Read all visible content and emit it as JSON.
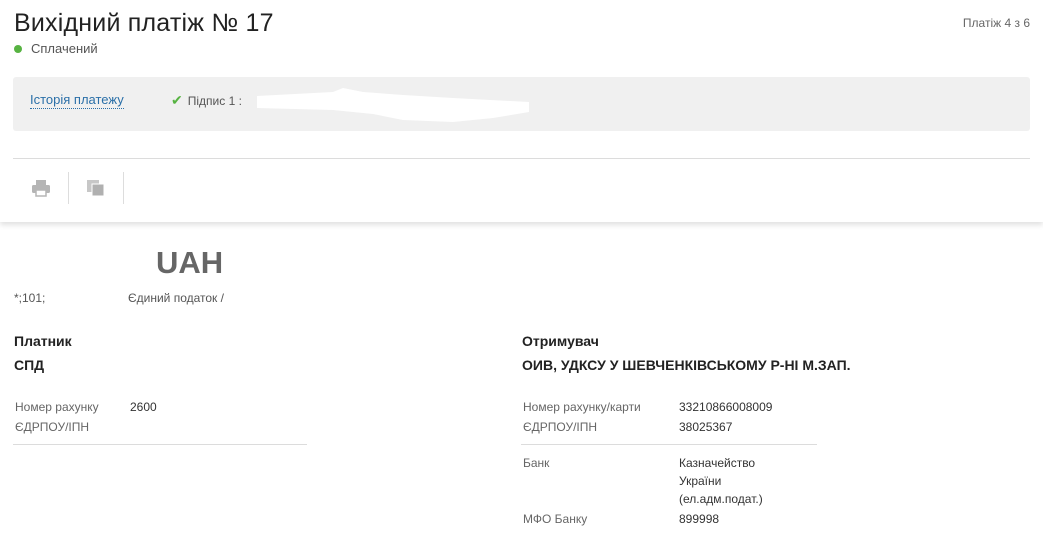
{
  "header": {
    "title": "Вихідний платіж № 17",
    "status": "Сплачений",
    "status_color": "#57b342",
    "counter": "Платіж 4 з 6"
  },
  "infobar": {
    "history_link": "Історія платежу",
    "signature_label": "Підпис 1 :"
  },
  "toolbar": {
    "items": [
      {
        "icon": "printer-icon"
      },
      {
        "icon": "copy-icon"
      }
    ]
  },
  "payment": {
    "currency": "UAH",
    "purpose_code": "*;101;",
    "purpose_text": "Єдиний податок /"
  },
  "payer": {
    "heading": "Платник",
    "name": "СПД",
    "account_label": "Номер рахунку",
    "account_value": "2600",
    "edrpou_label": "ЄДРПОУ/ІПН",
    "edrpou_value": ""
  },
  "recipient": {
    "heading": "Отримувач",
    "name": "ОИВ, УДКСУ У ШЕВЧЕНКІВСЬКОМУ Р-НІ М.ЗАП.",
    "account_label": "Номер рахунку/карти",
    "account_value": "33210866008009",
    "edrpou_label": "ЄДРПОУ/ІПН",
    "edrpou_value": "38025367",
    "bank_label": "Банк",
    "bank_value_line1": "Казначейство",
    "bank_value_line2": "України",
    "bank_value_line3": "(ел.адм.подат.)",
    "mfo_label": "МФО Банку",
    "mfo_value": "899998"
  }
}
